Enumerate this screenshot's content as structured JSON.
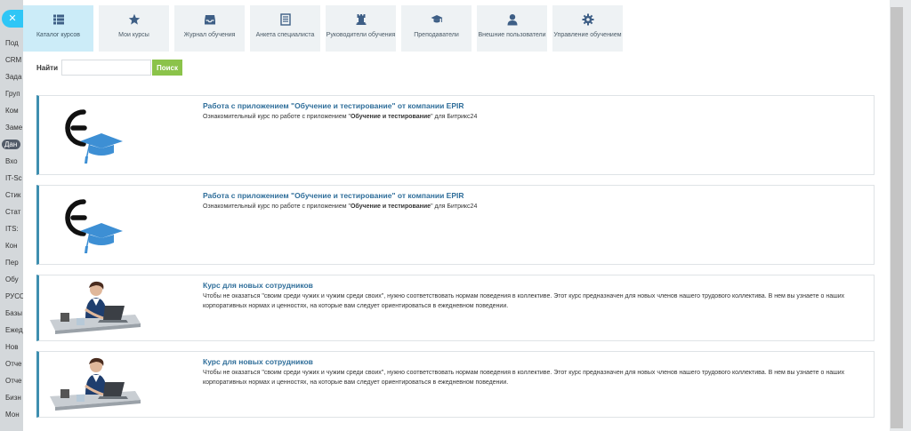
{
  "left_menu": {
    "items": [
      "Под",
      "CRM",
      "Зада",
      "Груп",
      "Ком",
      "Заме",
      "Дан",
      "Вхо",
      "IT-Sc",
      "Стик",
      "Стат",
      "ITS:",
      "Кон",
      "Пер",
      "Обу",
      "РУСО",
      "Базы",
      "Ежед",
      "Нов",
      "Отче",
      "Отче",
      "Бизн",
      "Мон"
    ],
    "active_index": 6
  },
  "tabs": [
    {
      "label": "Каталог курсов",
      "icon": "list-icon",
      "active": true
    },
    {
      "label": "Мои курсы",
      "icon": "star-icon",
      "active": false
    },
    {
      "label": "Журнал обучения",
      "icon": "inbox-icon",
      "active": false
    },
    {
      "label": "Анкета специалиста",
      "icon": "document-icon",
      "active": false
    },
    {
      "label": "Руководители обучения",
      "icon": "chess-rook-icon",
      "active": false
    },
    {
      "label": "Преподаватели",
      "icon": "graduation-cap-icon",
      "active": false
    },
    {
      "label": "Внешние пользователи",
      "icon": "user-icon",
      "active": false
    },
    {
      "label": "Управление обучением",
      "icon": "gear-icon",
      "active": false
    }
  ],
  "search": {
    "label": "Найти",
    "value": "",
    "placeholder": "",
    "button_label": "Поиск"
  },
  "courses": [
    {
      "title": "Работа с приложением \"Обучение и тестирование\" от компании EPIR",
      "desc_before": "Ознакомительный курс по работе с приложением \"",
      "desc_bold": "Обучение и тестирование",
      "desc_after": "\" для Битрикс24",
      "image": "epir-logo-graduation-cap"
    },
    {
      "title": "Работа с приложением \"Обучение и тестирование\" от компании EPIR",
      "desc_before": "Ознакомительный курс по работе с приложением \"",
      "desc_bold": "Обучение и тестирование",
      "desc_after": "\" для Битрикс24",
      "image": "epir-logo-graduation-cap"
    },
    {
      "title": "Курс для новых сотрудников",
      "desc_before": "Чтобы не оказаться \"своим среди чужих и чужим среди своих\", нужно соответствовать нормам поведения в коллективе. Этот курс предназначен для новых членов нашего трудового коллектива. В нем вы узнаете о наших корпоративных нормах и ценностях, на которые вам следует ориентироваться в ежедневном поведении.",
      "desc_bold": "",
      "desc_after": "",
      "image": "woman-at-laptop"
    },
    {
      "title": "Курс для новых сотрудников",
      "desc_before": "Чтобы не оказаться \"своим среди чужих и чужим среди своих\", нужно соответствовать нормам поведения в коллективе. Этот курс предназначен для новых членов нашего трудового коллектива. В нем вы узнаете о наших корпоративных нормах и ценностях, на которые вам следует ориентироваться в ежедневном поведении.",
      "desc_bold": "",
      "desc_after": "",
      "image": "woman-at-laptop"
    }
  ],
  "colors": {
    "accent": "#3e8fb0",
    "title": "#2f6e9a",
    "search_button": "#8bc34a",
    "tab_active": "#ccecf8",
    "tab_inactive": "#eef2f4",
    "icon": "#3e5f86"
  }
}
